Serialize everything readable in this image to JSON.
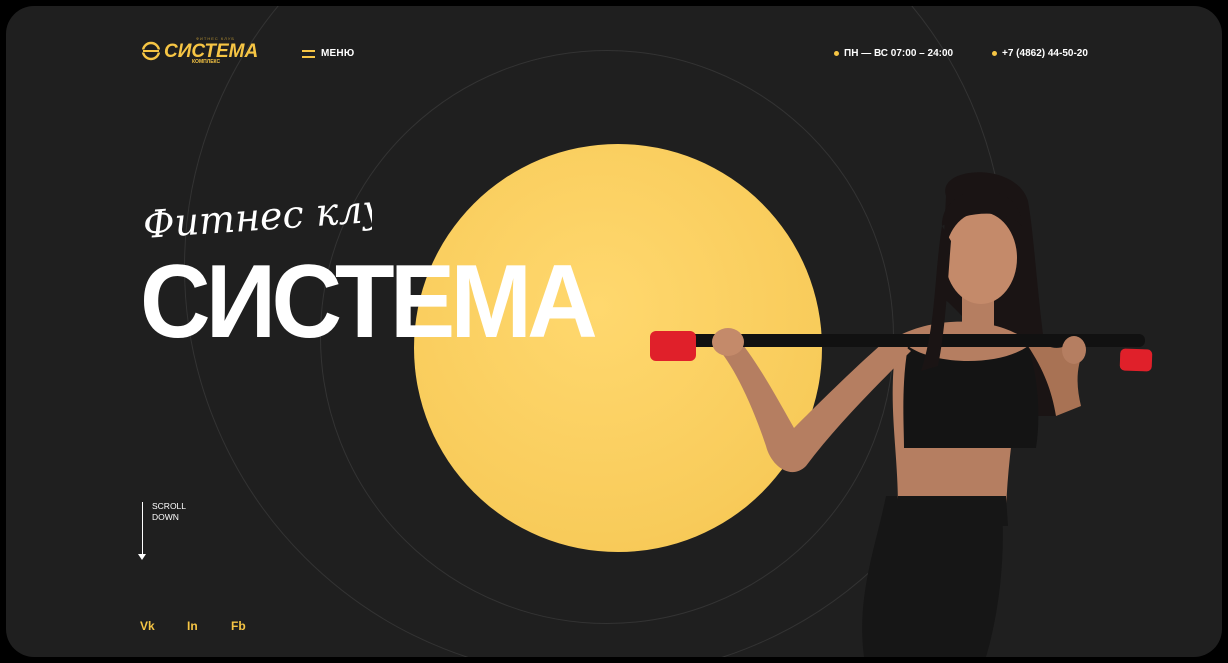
{
  "logo": {
    "text": "СИСТЕМА",
    "top_text": "ФИТНЕС КЛУБ",
    "bottom_text": "КОМПЛЕКС"
  },
  "nav": {
    "menu_label": "МЕНЮ"
  },
  "contacts": {
    "hours": "ПН — ВС 07:00 – 24:00",
    "phone": "+7 (4862) 44-50-20"
  },
  "hero": {
    "subtitle": "Фитнес клуб",
    "title": "СИСТЕМА"
  },
  "scroll": {
    "line1": "SCROLL",
    "line2": "DOWN"
  },
  "social": [
    "Vk",
    "In",
    "Fb"
  ],
  "colors": {
    "accent": "#f6c544",
    "background": "#1f1f1f",
    "circle": "#f8cb5a",
    "bar_end": "#e0202a"
  }
}
